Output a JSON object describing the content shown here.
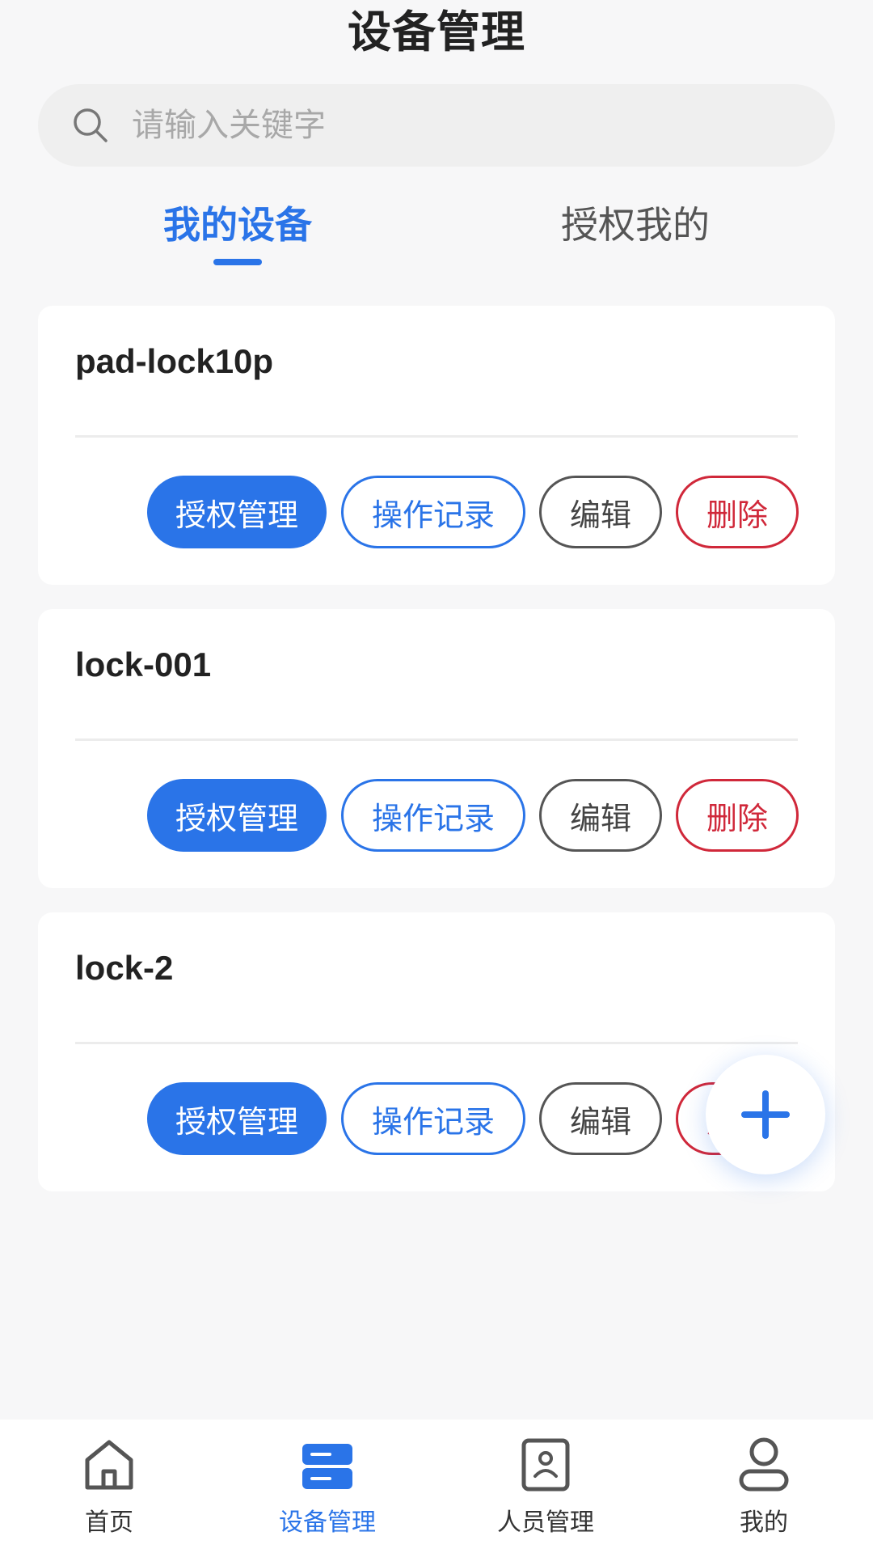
{
  "header": {
    "title": "设备管理"
  },
  "search": {
    "placeholder": "请输入关键字",
    "value": ""
  },
  "tabs": [
    {
      "label": "我的设备",
      "active": true
    },
    {
      "label": "授权我的",
      "active": false
    }
  ],
  "devices": [
    {
      "name": "pad-lock10p",
      "actions": {
        "auth": "授权管理",
        "log": "操作记录",
        "edit": "编辑",
        "delete": "删除"
      }
    },
    {
      "name": "lock-001",
      "actions": {
        "auth": "授权管理",
        "log": "操作记录",
        "edit": "编辑",
        "delete": "删除"
      }
    },
    {
      "name": "lock-2",
      "actions": {
        "auth": "授权管理",
        "log": "操作记录",
        "edit": "编辑",
        "delete": "删除"
      }
    }
  ],
  "fab": {
    "icon": "plus-icon"
  },
  "bottom_nav": [
    {
      "label": "首页",
      "icon": "home-icon",
      "active": false
    },
    {
      "label": "设备管理",
      "icon": "device-list-icon",
      "active": true
    },
    {
      "label": "人员管理",
      "icon": "person-card-icon",
      "active": false
    },
    {
      "label": "我的",
      "icon": "user-icon",
      "active": false
    }
  ],
  "colors": {
    "primary": "#2a74e8",
    "danger": "#d0283a",
    "neutral": "#555555",
    "background": "#f7f7f8"
  }
}
